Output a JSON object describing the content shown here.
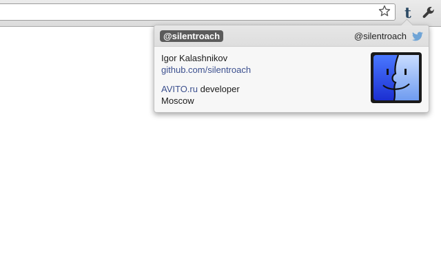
{
  "popup": {
    "badge_handle": "@silentroach",
    "header_handle": "@silentroach",
    "name": "Igor Kalashnikov",
    "link": "github.com/silentroach",
    "bio_link": "AVITO.ru",
    "bio_rest": " developer",
    "location": "Moscow"
  },
  "icons": {
    "bookmark": "star-icon",
    "extension": "tumblr-icon",
    "menu": "wrench-icon",
    "header": "twitter-bird-icon",
    "avatar": "finder-face-avatar"
  },
  "extension_glyph": "t",
  "colors": {
    "link": "#3b4f8e",
    "badge_bg": "#5b5b5b",
    "twitter": "#6fa4d6",
    "tumblr": "#2b4964"
  }
}
